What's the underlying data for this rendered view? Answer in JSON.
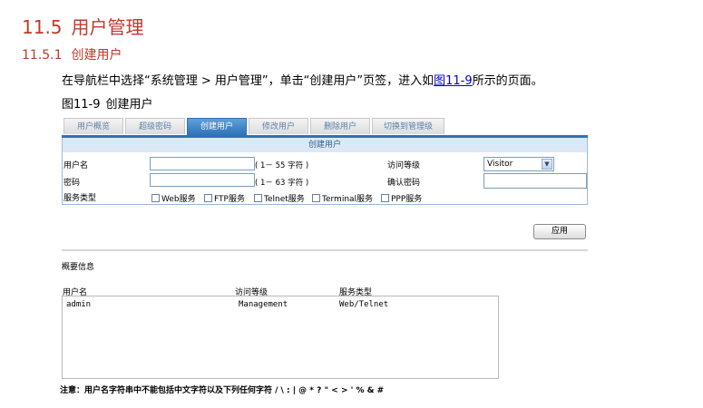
{
  "heading1": {
    "number": "11.5",
    "title": "用户管理"
  },
  "heading2": {
    "number": "11.5.1",
    "title": "创建用户"
  },
  "paragraph": {
    "before": "在导航栏中选择“系统管理 > 用户管理”，单击“创建用户”页签，进入如",
    "link": "图11-9",
    "after": "所示的页面。"
  },
  "caption": {
    "number": "图11-9",
    "title": "创建用户"
  },
  "tabs": [
    "用户概览",
    "超级密码",
    "创建用户",
    "修改用户",
    "删除用户",
    "切换到管理级"
  ],
  "form": {
    "title": "创建用户",
    "username_label": "用户名",
    "username_value": "",
    "username_hint": "( 1－ 55 字符 )",
    "access_label": "访问等级",
    "access_value": "Visitor",
    "password_label": "密码",
    "password_value": "",
    "password_hint": "( 1－ 63 字符 )",
    "confirm_label": "确认密码",
    "confirm_value": "",
    "service_label": "服务类型",
    "services": [
      "Web服务",
      "FTP服务",
      "Telnet服务",
      "Terminal服务",
      "PPP服务"
    ]
  },
  "apply_label": "应用",
  "summary": {
    "title": "概要信息",
    "columns": [
      "用户名",
      "访问等级",
      "服务类型"
    ],
    "rows": [
      [
        "admin",
        "Management",
        "Web/Telnet"
      ]
    ]
  },
  "note": "注意：用户名字符串中不能包括中文字符以及下列任何字符  /  \\  :  |  @  *  ?  \"  <  >  '  %  &  #"
}
